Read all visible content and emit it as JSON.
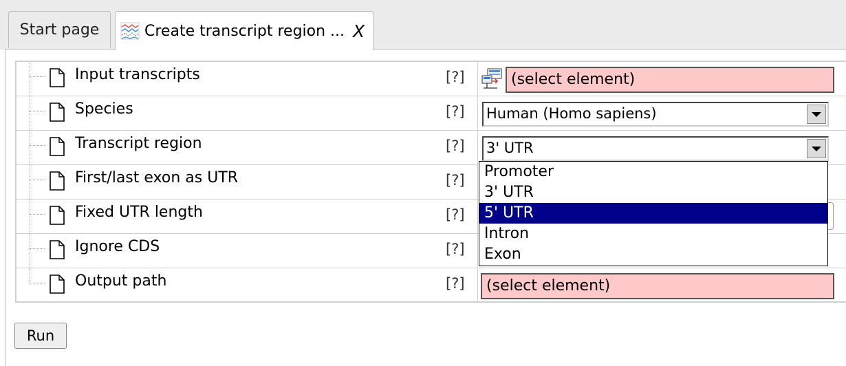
{
  "tabs": [
    {
      "label": "Start page",
      "active": false
    },
    {
      "label": "Create transcript region ...",
      "active": true,
      "icon": "transcript-region-icon",
      "close": "X"
    }
  ],
  "parameters": [
    {
      "name": "Input transcripts",
      "help": "[?]",
      "value": "(select element)",
      "control": "element-selector"
    },
    {
      "name": "Species",
      "help": "[?]",
      "value": "Human (Homo sapiens)",
      "control": "select"
    },
    {
      "name": "Transcript region",
      "help": "[?]",
      "value": "3' UTR",
      "control": "select"
    },
    {
      "name": "First/last exon as UTR",
      "help": "[?]"
    },
    {
      "name": "Fixed UTR length",
      "help": "[?]"
    },
    {
      "name": "Ignore CDS",
      "help": "[?]"
    },
    {
      "name": "Output path",
      "help": "[?]",
      "value": "(select element)",
      "control": "element-selector"
    }
  ],
  "dropdown": {
    "options": [
      "Promoter",
      "3' UTR",
      "5' UTR",
      "Intron",
      "Exon"
    ],
    "highlighted": "5' UTR"
  },
  "run_button": "Run",
  "colors": {
    "invalid_field": "#ffc9c9",
    "highlight": "#00008b",
    "tab_bar": "#ebebeb"
  }
}
